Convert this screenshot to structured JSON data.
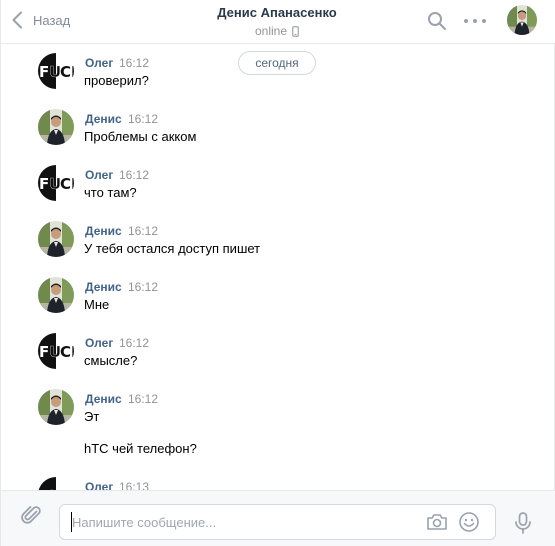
{
  "header": {
    "back_label": "Назад",
    "title": "Денис Апанасенко",
    "status": "online"
  },
  "date_separator": "сегодня",
  "messages": [
    {
      "author": "Олег",
      "time": "16:12",
      "text": "проверил?"
    },
    {
      "author": "Денис",
      "time": "16:12",
      "text": "Проблемы с акком"
    },
    {
      "author": "Олег",
      "time": "16:12",
      "text": "что там?"
    },
    {
      "author": "Денис",
      "time": "16:12",
      "text": "У тебя остался доступ пишет"
    },
    {
      "author": "Денис",
      "time": "16:12",
      "text": "Мне"
    },
    {
      "author": "Олег",
      "time": "16:12",
      "text": "смысле?"
    },
    {
      "author": "Денис",
      "time": "16:12",
      "text": "Эт",
      "text2": "hTC чей телефон?"
    },
    {
      "author": "Олег",
      "time": "16:13",
      "text": ""
    }
  ],
  "composer": {
    "placeholder": "Напишите сообщение..."
  },
  "colors": {
    "link": "#42648b",
    "muted": "#939393",
    "border": "#e7e8ec",
    "icon": "#99a2ad"
  },
  "icons": {
    "back": "chevron-left-icon",
    "search": "search-icon",
    "more": "more-dots-icon",
    "mobile": "mobile-phone-icon",
    "attach": "paperclip-icon",
    "camera": "camera-icon",
    "emoji": "smile-icon",
    "voice": "microphone-icon"
  }
}
